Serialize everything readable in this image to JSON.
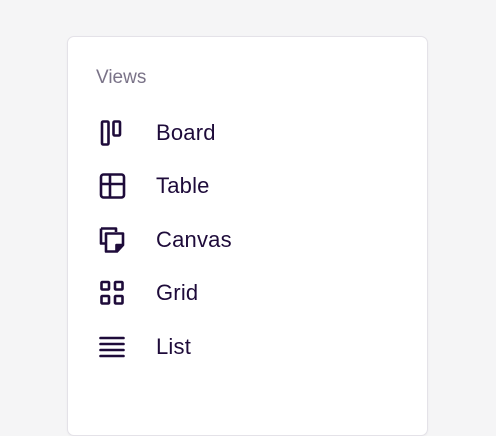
{
  "views_panel": {
    "title": "Views",
    "items": [
      {
        "label": "Board",
        "icon": "board-icon"
      },
      {
        "label": "Table",
        "icon": "table-icon"
      },
      {
        "label": "Canvas",
        "icon": "canvas-icon"
      },
      {
        "label": "Grid",
        "icon": "grid-icon"
      },
      {
        "label": "List",
        "icon": "list-icon"
      }
    ]
  },
  "colors": {
    "icon": "#1e0b3a",
    "text": "#1e0b3a",
    "muted": "#7a7388",
    "background": "#f5f5f6",
    "panel": "#ffffff"
  }
}
